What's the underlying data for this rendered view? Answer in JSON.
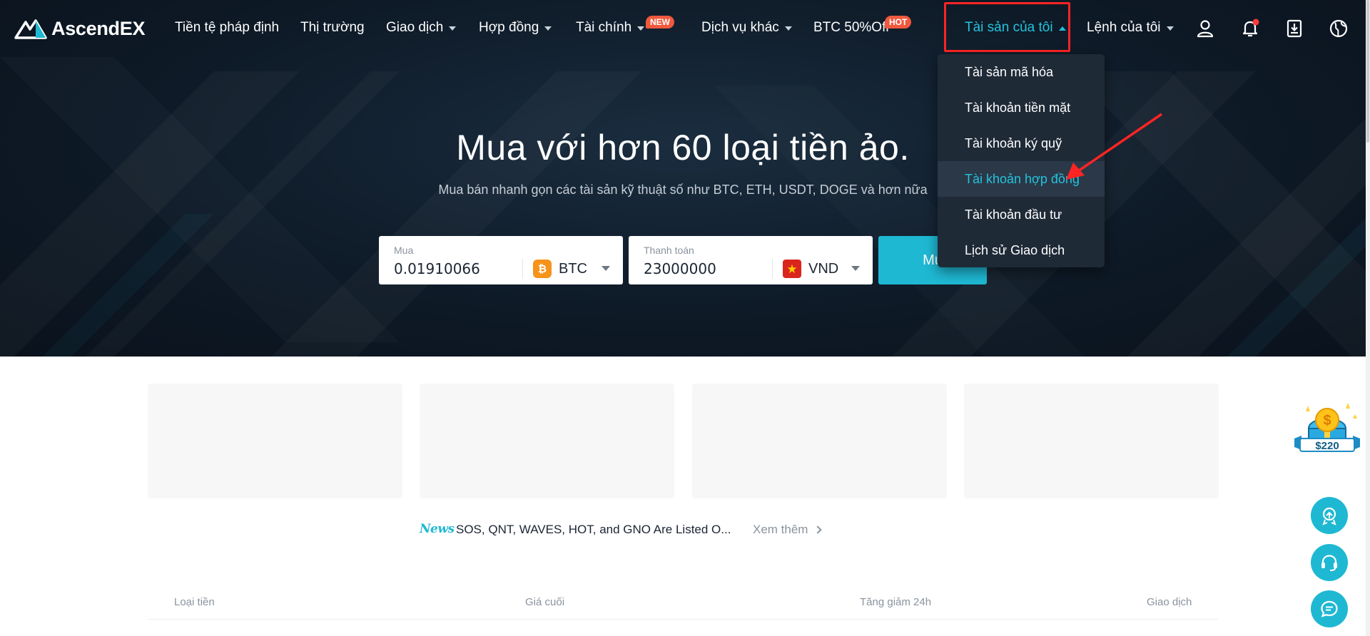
{
  "brand": {
    "name": "AscendEX"
  },
  "nav": {
    "items": [
      {
        "label": "Tiền tệ pháp định"
      },
      {
        "label": "Thị trường"
      },
      {
        "label": "Giao dịch"
      },
      {
        "label": "Hợp đồng"
      },
      {
        "label": "Tài chính",
        "badge": "NEW"
      },
      {
        "label": "Dịch vụ khác"
      },
      {
        "label": "BTC 50%Off",
        "badge": "HOT"
      },
      {
        "label": "Tài sản của tôi"
      },
      {
        "label": "Lệnh của tôi"
      }
    ],
    "icons": [
      "user-icon",
      "bell-icon",
      "download-icon",
      "globe-icon"
    ],
    "notification_color": "#ff3b3b"
  },
  "dropdown": {
    "items": [
      "Tài sản mã hóa",
      "Tài khoản tiền mặt",
      "Tài khoản ký quỹ",
      "Tài khoản hợp đồng",
      "Tài khoản đầu tư",
      "Lịch sử Giao dịch"
    ],
    "active": "Tài khoản hợp đồng"
  },
  "hero": {
    "title": "Mua với hơn 60 loại tiền ảo.",
    "subtitle": "Mua bán nhanh gọn các tài sản kỹ thuật số như BTC, ETH, USDT, DOGE và hơn nữa"
  },
  "buy_form": {
    "buy": {
      "label": "Mua",
      "value": "0.01910066",
      "currency": "BTC",
      "coin_glyph": "₿"
    },
    "pay": {
      "label": "Thanh toán",
      "value": "23000000",
      "currency": "VND"
    },
    "button_label": "Mu"
  },
  "news": {
    "tag": "News",
    "headline": "SOS, QNT, WAVES, HOT, and GNO Are Listed O...",
    "more_label": "Xem thêm"
  },
  "market_table": {
    "columns": [
      "Loại tiền",
      "Giá cuối",
      "Tăng giảm 24h",
      "Giao dịch"
    ]
  },
  "promo": {
    "amount": "$220"
  },
  "colors": {
    "accent": "#1fb8d3",
    "highlight_box": "#ff2424",
    "badge": "#f0593e",
    "dropdown_bg": "#1f2a37"
  }
}
